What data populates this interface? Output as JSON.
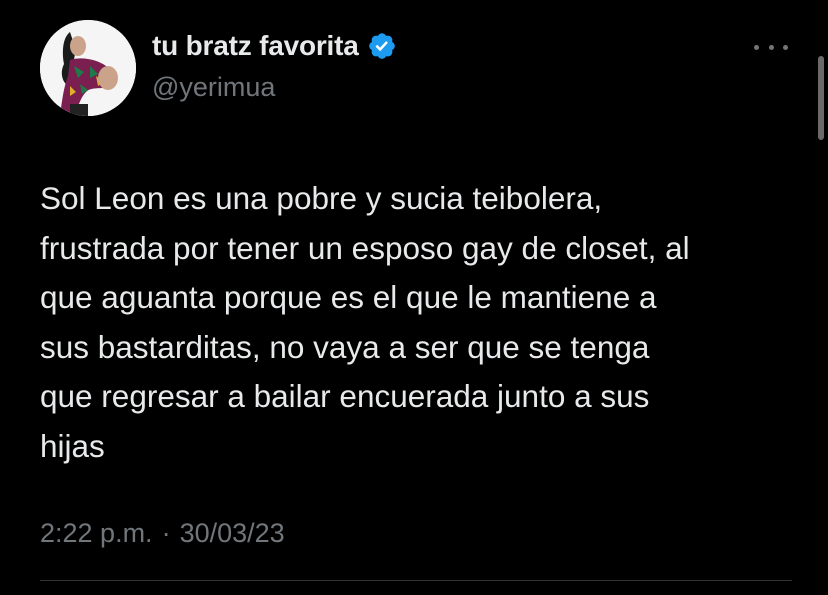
{
  "author": {
    "display_name": "tu bratz favorita",
    "handle": "@yerimua",
    "verified": true,
    "avatar_icon": "profile-avatar"
  },
  "colors": {
    "background": "#000000",
    "primary_text": "#e7e9ea",
    "secondary_text": "#71767b",
    "verified_badge": "#1d9bf0",
    "divider": "#2f3336"
  },
  "menu": {
    "icon": "more-options-icon"
  },
  "tweet": {
    "lines": [
      "Sol Leon es una pobre y sucia teibolera,",
      "frustrada por tener un esposo gay de closet, al",
      "que aguanta porque es el que le mantiene a",
      "sus bastarditas, no vaya a ser que se tenga",
      "que regresar a bailar encuerada junto a sus",
      "hijas"
    ]
  },
  "meta": {
    "time": "2:22 p.m.",
    "separator": "·",
    "date": "30/03/23"
  }
}
